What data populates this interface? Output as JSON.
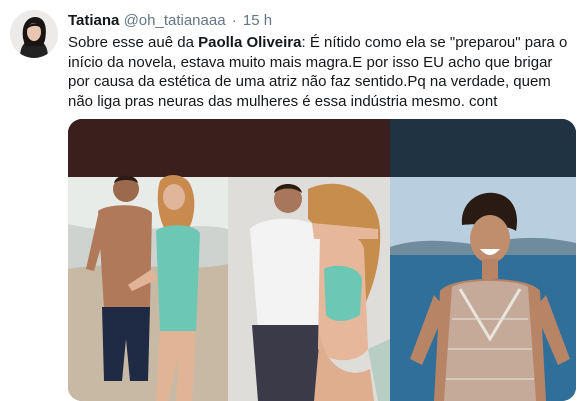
{
  "tweet": {
    "author_name": "Tatiana",
    "author_handle": "@oh_tatianaaa",
    "separator": "·",
    "time": "15 h",
    "text_part1": "Sobre esse auê da ",
    "text_bold": "Paolla Oliveira",
    "text_part2": ": É nítido como ela se \"preparou\" para o início da novela, estava muito mais magra.E por isso EU acho que brigar por causa da estética de uma atriz não faz sentido.Pq na verdade, quem não liga pras neuras das mulheres é essa indústria mesmo. cont"
  },
  "media": {
    "panels": [
      "beach-couple-photo",
      "embracing-couple-photo",
      "smiling-woman-photo"
    ]
  },
  "colors": {
    "name": "#14171a",
    "secondary": "#657786",
    "media_top_band_left": "#3b1f1c",
    "media_top_band_right": "#1f3342",
    "sea": "#2f6f9a",
    "sky": "#b9cfe0",
    "swimsuit": "#6cc7b5"
  }
}
